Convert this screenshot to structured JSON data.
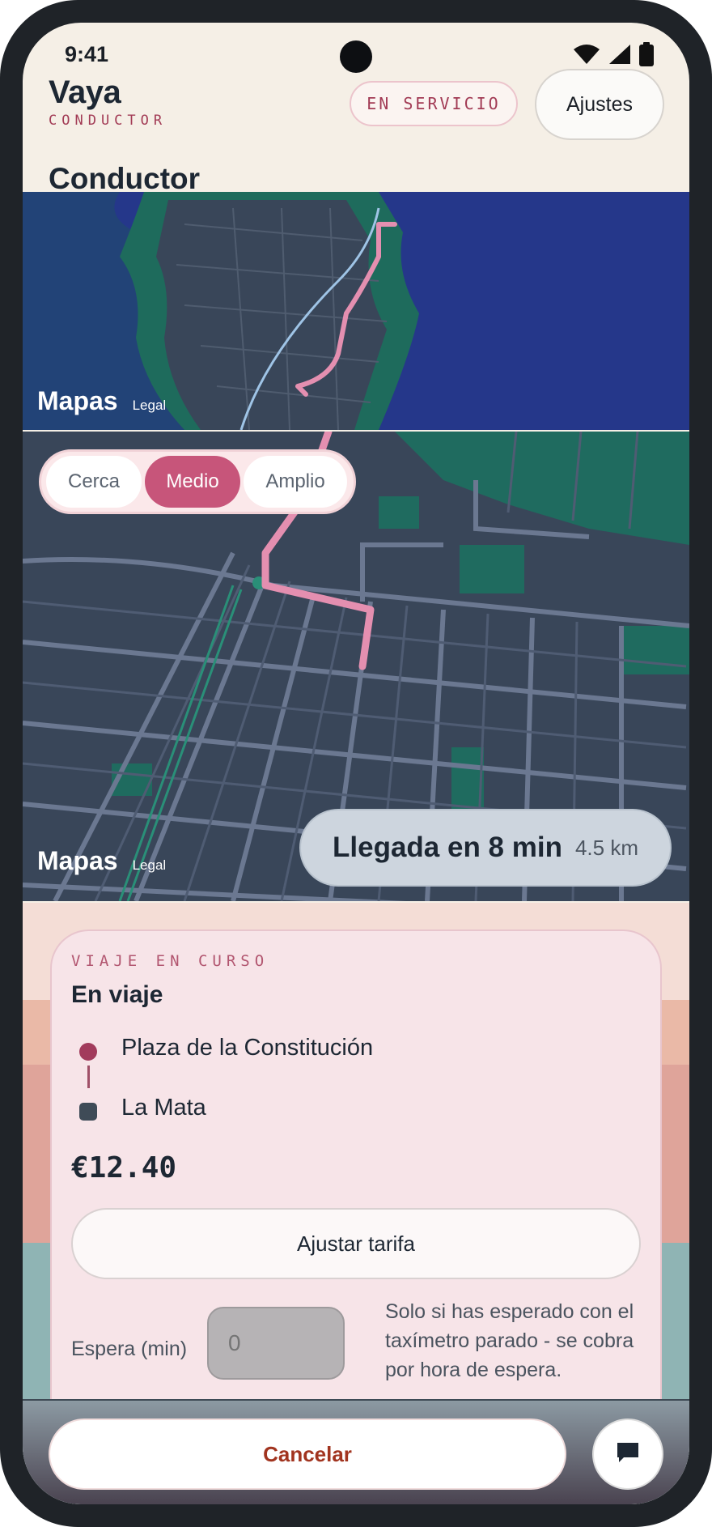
{
  "status_bar": {
    "time": "9:41"
  },
  "header": {
    "brand_title": "Vaya",
    "brand_subtitle": "CONDUCTOR",
    "status_pill": "EN SERVICIO",
    "settings_label": "Ajustes"
  },
  "section_title": "Conductor",
  "map_overview": {
    "brand": "Mapas",
    "legal": "Legal"
  },
  "map_detail": {
    "brand": "Mapas",
    "legal": "Legal",
    "zoom_options": [
      "Cerca",
      "Medio",
      "Amplio"
    ],
    "zoom_selected": "Medio",
    "eta_label": "Llegada en 8 min",
    "eta_distance": "4.5 km"
  },
  "trip_card": {
    "kicker": "VIAJE EN CURSO",
    "status": "En viaje",
    "origin": "Plaza de la Constitución",
    "destination": "La Mata",
    "fare": "€12.40",
    "adjust_fare_label": "Ajustar tarifa",
    "wait_label": "Espera (min)",
    "wait_placeholder": "0",
    "wait_help": "Solo si has esperado con el taxímetro parado - se cobra por hora de espera."
  },
  "bottom_bar": {
    "cancel_label": "Cancelar"
  },
  "colors": {
    "accent": "#c7557a",
    "brand_red": "#a23b55",
    "water": "#25378a",
    "land": "#394659",
    "park": "#1f6b5f",
    "route": "#e48fb0"
  }
}
